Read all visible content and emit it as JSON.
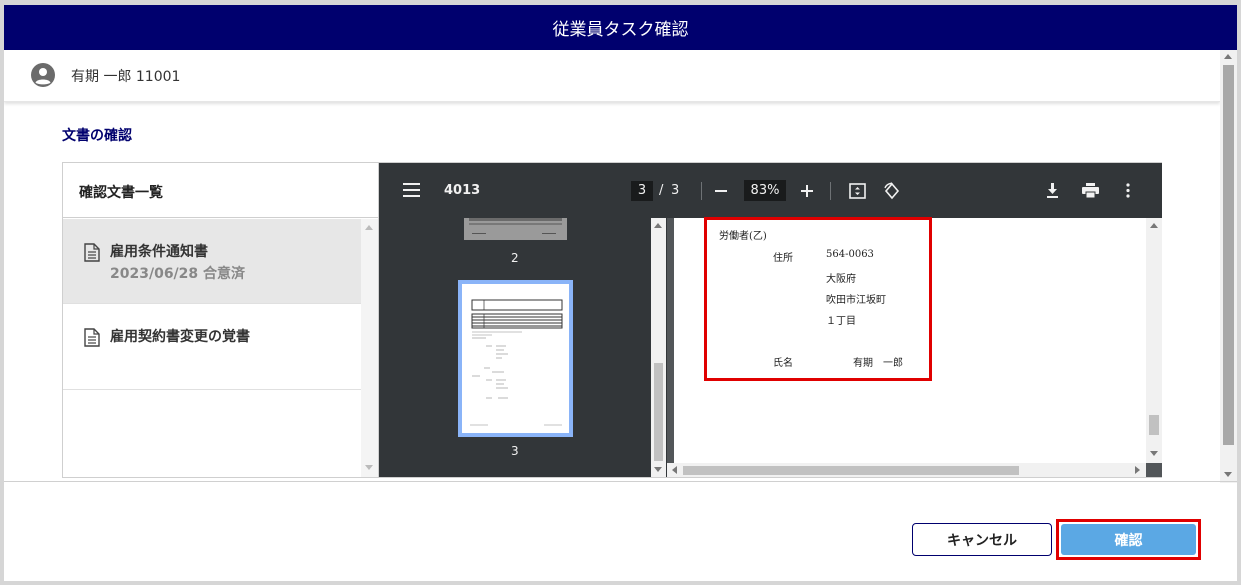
{
  "window": {
    "title": "従業員タスク確認"
  },
  "user": {
    "name": "有期 一郎 11001"
  },
  "section": {
    "title": "文書の確認"
  },
  "doc_list": {
    "header": "確認文書一覧",
    "items": [
      {
        "title": "雇用条件通知書",
        "subtitle": "2023/06/28 合意済"
      },
      {
        "title": "雇用契約書変更の覚書",
        "subtitle": ""
      }
    ]
  },
  "viewer": {
    "file_name": "4013",
    "current_page": "3",
    "page_separator": "/",
    "total_pages": "3",
    "zoom": "83%",
    "thumbnails": [
      {
        "label": "2"
      },
      {
        "label": "3"
      }
    ],
    "page_content": {
      "party_label": "労働者(乙)",
      "address_label": "住所",
      "postal_code": "564-0063",
      "prefecture": "大阪府",
      "city": "吹田市江坂町",
      "block": "１丁目",
      "name_label": "氏名",
      "name_value": "有期　一郎"
    }
  },
  "actions": {
    "cancel_label": "キャンセル",
    "confirm_label": "確認"
  },
  "colors": {
    "header_bg": "#00006e",
    "confirm_bg": "#5ba8e4",
    "highlight": "#e00000"
  }
}
